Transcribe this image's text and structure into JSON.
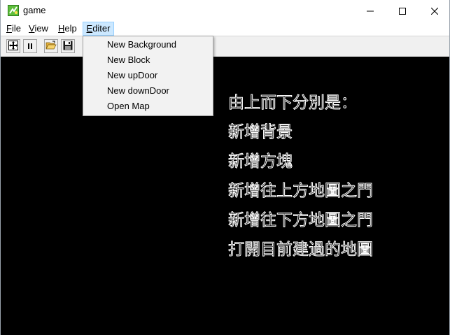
{
  "window": {
    "title": "game",
    "icon": "game-app-icon",
    "controls": [
      "minimize-icon",
      "maximize-icon",
      "close-icon"
    ]
  },
  "menubar": {
    "items": [
      {
        "label": "File",
        "mnemonic": "F",
        "rest": "ile"
      },
      {
        "label": "View",
        "mnemonic": "V",
        "rest": "iew"
      },
      {
        "label": "Help",
        "mnemonic": "H",
        "rest": "elp"
      },
      {
        "label": "Editer",
        "mnemonic": "E",
        "rest": "diter",
        "active": true
      }
    ]
  },
  "toolbar": {
    "buttons": [
      {
        "icon": "add-grid-icon"
      },
      {
        "icon": "pause-icon"
      },
      {
        "icon": "open-folder-icon"
      },
      {
        "icon": "save-disk-icon"
      }
    ]
  },
  "editer_menu": {
    "items": [
      "New Background",
      "New Block",
      "New upDoor",
      "New downDoor",
      "Open Map"
    ]
  },
  "canvas": {
    "background": "#000000",
    "lines": [
      "由上而下分別是：",
      "新增背景",
      "新增方塊",
      "新增往上方地圖之門",
      "新增往下方地圖之門",
      "打開目前建過的地圖"
    ]
  },
  "colors": {
    "menu_active_bg": "#cce8ff",
    "menu_active_border": "#99d1ff",
    "dropdown_bg": "#f2f2f2",
    "toolbar_bg": "#f0f0f0",
    "canvas_text_outline": "#ffffff"
  }
}
